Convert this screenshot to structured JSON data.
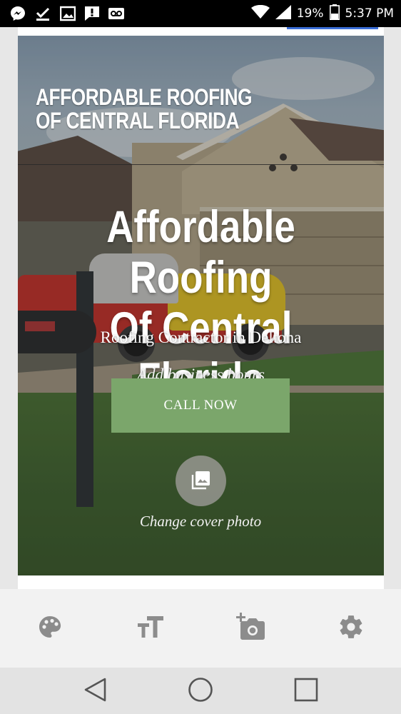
{
  "status_bar": {
    "battery": "19%",
    "time": "5:37 PM",
    "left_icons": [
      "messenger-icon",
      "checkmark-download-icon",
      "gallery-icon",
      "alert-icon",
      "voicemail-icon"
    ],
    "right_icons": [
      "wifi-icon",
      "signal-icon",
      "battery-icon"
    ]
  },
  "site": {
    "name": "AFFORDABLE ROOFING OF CENTRAL FLORIDA",
    "headline_line1": "Affordable Roofing",
    "headline_line2": "Of Central Florida",
    "subtitle": "Roofing Contractor in Deltona",
    "hours": "Add business hours",
    "cta_label": "CALL NOW",
    "change_cover_label": "Change cover photo"
  },
  "toolbar": {
    "items": [
      {
        "icon": "palette-icon"
      },
      {
        "icon": "text-size-icon"
      },
      {
        "icon": "add-photo-icon"
      },
      {
        "icon": "gear-icon"
      }
    ]
  },
  "nav": {
    "items": [
      {
        "icon": "back-icon"
      },
      {
        "icon": "home-icon"
      },
      {
        "icon": "recents-icon"
      }
    ]
  },
  "colors": {
    "cta": "#7ba66b",
    "toolbar_icon": "#8a8a8a",
    "status_bar": "#000000"
  }
}
